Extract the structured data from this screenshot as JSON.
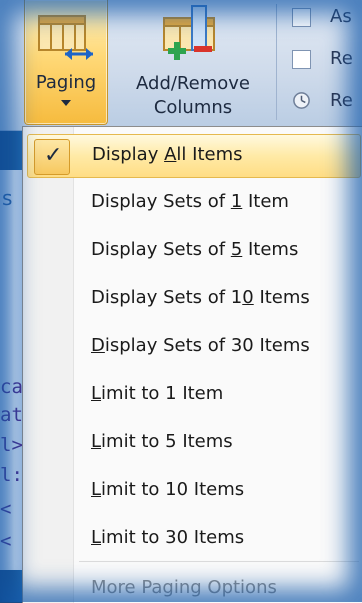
{
  "ribbon": {
    "paging_label": "Paging",
    "add_remove_label_line1": "Add/Remove",
    "add_remove_label_line2": "Columns",
    "options": [
      {
        "label": "As",
        "type": "checkbox"
      },
      {
        "label": "Re",
        "type": "checkbox"
      },
      {
        "label": "Re",
        "type": "clock"
      }
    ]
  },
  "menu": {
    "items": [
      {
        "pre": "Display ",
        "u": "A",
        "post": "ll Items",
        "selected": true
      },
      {
        "pre": "Display Sets of ",
        "u": "1",
        "post": " Item"
      },
      {
        "pre": "Display Sets of ",
        "u": "5",
        "post": " Items"
      },
      {
        "pre": "Display Sets of 1",
        "u": "0",
        "post": " Items"
      },
      {
        "pre": "",
        "u": "D",
        "post": "isplay Sets of 30 Items"
      },
      {
        "pre": "",
        "u": "L",
        "post": "imit to 1 Item"
      },
      {
        "pre": "",
        "u": "L",
        "post": "imit to 5 Items"
      },
      {
        "pre": "",
        "u": "L",
        "post": "imit to 10 Items"
      },
      {
        "pre": "",
        "u": "L",
        "post": "imit to 30 Items"
      }
    ],
    "footer": "More Paging Options",
    "check_glyph": "✓"
  },
  "code": {
    "s_char": "s",
    "lines": [
      "ca",
      "at",
      "l>",
      "l:",
      "<",
      "<"
    ]
  },
  "colors": {
    "accent": "#ffd978",
    "frame": "#2a78c2"
  }
}
